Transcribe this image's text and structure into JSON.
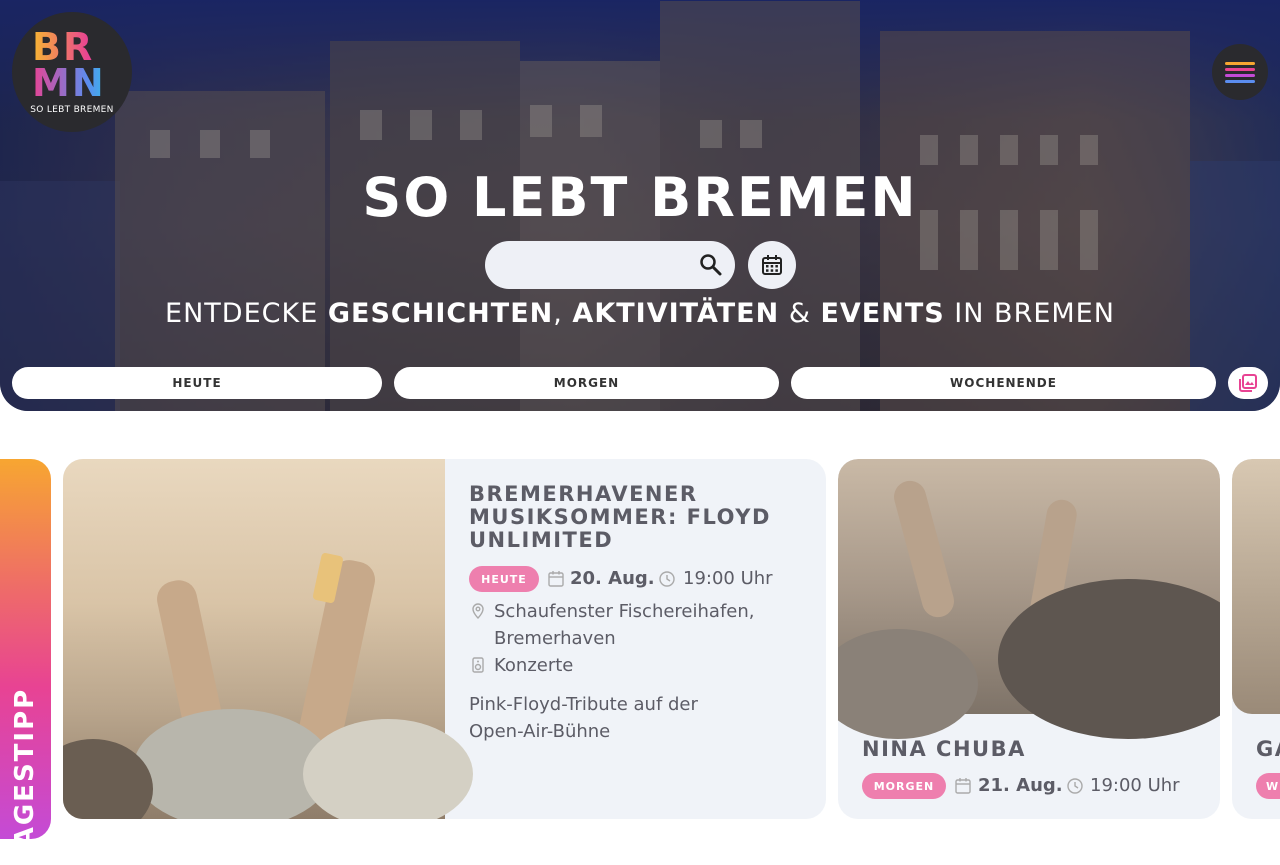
{
  "logo": {
    "line1": "BR",
    "line2": "MN",
    "subtitle": "SO LEBT BREMEN"
  },
  "hero": {
    "title": "SO LEBT BREMEN",
    "search_placeholder": "",
    "tagline": {
      "prefix": "ENTDECKE ",
      "w1": "GESCHICHTEN",
      "sep1": ", ",
      "w2": "AKTIVITÄTEN",
      "sep2": " & ",
      "w3": "EVENTS",
      "suffix": " IN BREMEN"
    }
  },
  "filters": [
    "HEUTE",
    "MORGEN",
    "WOCHENENDE"
  ],
  "tip": {
    "label": "TAGESTIPP"
  },
  "featured": {
    "title": "BREMERHAVENER MUSIKSOMMER: FLOYD UNLIMITED",
    "badge": "HEUTE",
    "date": "20. Aug.",
    "time": "19:00 Uhr",
    "location_line1": "Schaufenster Fischereihafen,",
    "location_line2": "Bremerhaven",
    "category": "Konzerte",
    "description_line1": "Pink-Floyd-Tribute auf der",
    "description_line2": "Open-Air-Bühne"
  },
  "card2": {
    "title": "NINA CHUBA",
    "badge": "MORGEN",
    "date": "21. Aug.",
    "time": "19:00 Uhr"
  },
  "card3": {
    "title": "GA",
    "badge": "W"
  },
  "colors": {
    "badge": "#ee7fae",
    "card_bg": "#f0f3f8",
    "menu_lines": [
      "#f7a631",
      "#e84393",
      "#c44bd6",
      "#5b8def"
    ]
  }
}
